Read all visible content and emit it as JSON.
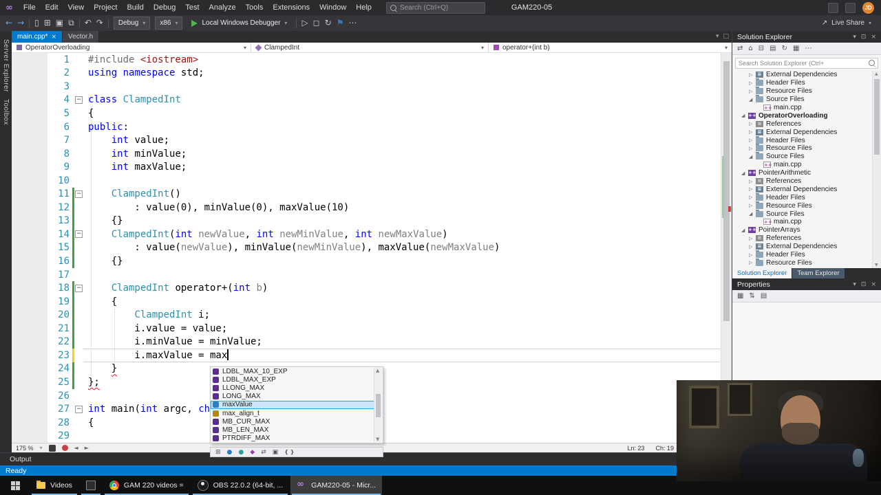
{
  "menu": {
    "items": [
      "File",
      "Edit",
      "View",
      "Project",
      "Build",
      "Debug",
      "Test",
      "Analyze",
      "Tools",
      "Extensions",
      "Window",
      "Help"
    ],
    "search_placeholder": "Search (Ctrl+Q)",
    "title": "GAM220-05",
    "avatar": "JD"
  },
  "toolbar": {
    "config": "Debug",
    "platform": "x86",
    "run": "Local Windows Debugger",
    "live_share": "Live Share"
  },
  "doc_tabs": [
    {
      "label": "main.cpp*",
      "active": true
    },
    {
      "label": "Vector.h",
      "active": false
    }
  ],
  "breadcrumb": {
    "scope": "OperatorOverloading",
    "type": "ClampedInt",
    "member": "operator+(int b)"
  },
  "side_tabs": [
    "Server Explorer",
    "Toolbox"
  ],
  "editor": {
    "zoom": "175 %",
    "status": {
      "line": "Ln: 23",
      "col": "Ch: 19"
    },
    "lines": [
      {
        "n": 1,
        "t": [
          [
            "pp",
            "#include "
          ],
          [
            "str",
            "<iostream>"
          ]
        ]
      },
      {
        "n": 2,
        "t": [
          [
            "kw",
            "using"
          ],
          [
            "pl",
            " "
          ],
          [
            "kw",
            "namespace"
          ],
          [
            "pl",
            " std;"
          ]
        ]
      },
      {
        "n": 3,
        "t": []
      },
      {
        "n": 4,
        "fold": true,
        "t": [
          [
            "kw",
            "class"
          ],
          [
            "pl",
            " "
          ],
          [
            "ty",
            "ClampedInt"
          ]
        ]
      },
      {
        "n": 5,
        "t": [
          [
            "pl",
            "{"
          ]
        ]
      },
      {
        "n": 6,
        "t": [
          [
            "kw",
            "public"
          ],
          [
            "pl",
            ":"
          ]
        ]
      },
      {
        "n": 7,
        "t": [
          [
            "pl",
            "    "
          ],
          [
            "kw",
            "int"
          ],
          [
            "pl",
            " value;"
          ]
        ]
      },
      {
        "n": 8,
        "t": [
          [
            "pl",
            "    "
          ],
          [
            "kw",
            "int"
          ],
          [
            "pl",
            " minValue;"
          ]
        ]
      },
      {
        "n": 9,
        "t": [
          [
            "pl",
            "    "
          ],
          [
            "kw",
            "int"
          ],
          [
            "pl",
            " maxValue;"
          ]
        ]
      },
      {
        "n": 10,
        "t": []
      },
      {
        "n": 11,
        "fold": true,
        "chg": "g",
        "t": [
          [
            "pl",
            "    "
          ],
          [
            "ty",
            "ClampedInt"
          ],
          [
            "pl",
            "()"
          ]
        ]
      },
      {
        "n": 12,
        "chg": "g",
        "t": [
          [
            "pl",
            "        : value(0), minValue(0), maxValue(10)"
          ]
        ]
      },
      {
        "n": 13,
        "chg": "g",
        "t": [
          [
            "pl",
            "    {}"
          ]
        ]
      },
      {
        "n": 14,
        "fold": true,
        "chg": "g",
        "t": [
          [
            "pl",
            "    "
          ],
          [
            "ty",
            "ClampedInt"
          ],
          [
            "pl",
            "("
          ],
          [
            "kw",
            "int"
          ],
          [
            "pl",
            " "
          ],
          [
            "pa",
            "newValue"
          ],
          [
            "pl",
            ", "
          ],
          [
            "kw",
            "int"
          ],
          [
            "pl",
            " "
          ],
          [
            "pa",
            "newMinValue"
          ],
          [
            "pl",
            ", "
          ],
          [
            "kw",
            "int"
          ],
          [
            "pl",
            " "
          ],
          [
            "pa",
            "newMaxValue"
          ],
          [
            "pl",
            ")"
          ]
        ]
      },
      {
        "n": 15,
        "chg": "g",
        "t": [
          [
            "pl",
            "        : value("
          ],
          [
            "pa",
            "newValue"
          ],
          [
            "pl",
            "), minValue("
          ],
          [
            "pa",
            "newMinValue"
          ],
          [
            "pl",
            "), maxValue("
          ],
          [
            "pa",
            "newMaxValue"
          ],
          [
            "pl",
            ")"
          ]
        ]
      },
      {
        "n": 16,
        "chg": "g",
        "t": [
          [
            "pl",
            "    {}"
          ]
        ]
      },
      {
        "n": 17,
        "t": []
      },
      {
        "n": 18,
        "fold": true,
        "chg": "g",
        "t": [
          [
            "pl",
            "    "
          ],
          [
            "ty",
            "ClampedInt"
          ],
          [
            "pl",
            " operator+("
          ],
          [
            "kw",
            "int"
          ],
          [
            "pl",
            " "
          ],
          [
            "pa",
            "b"
          ],
          [
            "pl",
            ")"
          ]
        ]
      },
      {
        "n": 19,
        "chg": "g",
        "t": [
          [
            "pl",
            "    {"
          ]
        ]
      },
      {
        "n": 20,
        "chg": "g",
        "t": [
          [
            "pl",
            "        "
          ],
          [
            "ty",
            "ClampedInt"
          ],
          [
            "pl",
            " i;"
          ]
        ]
      },
      {
        "n": 21,
        "chg": "g",
        "t": [
          [
            "pl",
            "        i.value = value;"
          ]
        ]
      },
      {
        "n": 22,
        "chg": "g",
        "t": [
          [
            "pl",
            "        i.minValue = minValue;"
          ]
        ]
      },
      {
        "n": 23,
        "chg": "y",
        "caret": true,
        "cur": true,
        "t": [
          [
            "pl",
            "        i.maxValue = max"
          ]
        ]
      },
      {
        "n": 24,
        "chg": "g",
        "t": [
          [
            "pl",
            "    "
          ],
          [
            "sq",
            "}"
          ]
        ]
      },
      {
        "n": 25,
        "chg": "g",
        "t": [
          [
            "sq",
            "};"
          ]
        ]
      },
      {
        "n": 26,
        "t": []
      },
      {
        "n": 27,
        "fold": true,
        "t": [
          [
            "kw",
            "int"
          ],
          [
            "pl",
            " main("
          ],
          [
            "kw",
            "int"
          ],
          [
            "pl",
            " argc, "
          ],
          [
            "kw",
            "ch"
          ]
        ]
      },
      {
        "n": 28,
        "t": [
          [
            "pl",
            "{"
          ]
        ]
      },
      {
        "n": 29,
        "t": []
      }
    ]
  },
  "intellisense": {
    "items": [
      {
        "icon": "macro",
        "label": "LDBL_MAX_10_EXP"
      },
      {
        "icon": "macro",
        "label": "LDBL_MAX_EXP"
      },
      {
        "icon": "macro",
        "label": "LLONG_MAX"
      },
      {
        "icon": "macro",
        "label": "LONG_MAX"
      },
      {
        "icon": "field",
        "label": "maxValue",
        "selected": true
      },
      {
        "icon": "struct",
        "label": "max_align_t"
      },
      {
        "icon": "macro",
        "label": "MB_CUR_MAX"
      },
      {
        "icon": "macro",
        "label": "MB_LEN_MAX"
      },
      {
        "icon": "macro",
        "label": "PTRDIFF_MAX"
      }
    ],
    "toolbar_icons": [
      "grid",
      "dotb",
      "dott",
      "diamond",
      "swap",
      "box",
      "braces"
    ]
  },
  "solution_explorer": {
    "title": "Solution Explorer",
    "toolbar_icons": [
      "sync",
      "home",
      "collapse",
      "files",
      "refresh",
      "props",
      "more"
    ],
    "search_placeholder": "Search Solution Explorer (Ctrl+",
    "tree": [
      {
        "ind": 2,
        "exp": "c",
        "icon": "ext",
        "label": "External Dependencies"
      },
      {
        "ind": 2,
        "exp": "c",
        "icon": "folder",
        "label": "Header Files"
      },
      {
        "ind": 2,
        "exp": "c",
        "icon": "folder",
        "label": "Resource Files"
      },
      {
        "ind": 2,
        "exp": "e",
        "icon": "folder",
        "label": "Source Files"
      },
      {
        "ind": 3,
        "exp": "",
        "icon": "cpp",
        "label": "main.cpp"
      },
      {
        "ind": 1,
        "exp": "e",
        "icon": "proj",
        "label": "OperatorOverloading",
        "bold": true
      },
      {
        "ind": 2,
        "exp": "c",
        "icon": "ref",
        "label": "References"
      },
      {
        "ind": 2,
        "exp": "c",
        "icon": "ext",
        "label": "External Dependencies"
      },
      {
        "ind": 2,
        "exp": "c",
        "icon": "folder",
        "label": "Header Files"
      },
      {
        "ind": 2,
        "exp": "c",
        "icon": "folder",
        "label": "Resource Files"
      },
      {
        "ind": 2,
        "exp": "e",
        "icon": "folder",
        "label": "Source Files"
      },
      {
        "ind": 3,
        "exp": "",
        "icon": "cpp",
        "label": "main.cpp"
      },
      {
        "ind": 1,
        "exp": "e",
        "icon": "proj",
        "label": "PointerArithmetic"
      },
      {
        "ind": 2,
        "exp": "c",
        "icon": "ref",
        "label": "References"
      },
      {
        "ind": 2,
        "exp": "c",
        "icon": "ext",
        "label": "External Dependencies"
      },
      {
        "ind": 2,
        "exp": "c",
        "icon": "folder",
        "label": "Header Files"
      },
      {
        "ind": 2,
        "exp": "c",
        "icon": "folder",
        "label": "Resource Files"
      },
      {
        "ind": 2,
        "exp": "e",
        "icon": "folder",
        "label": "Source Files"
      },
      {
        "ind": 3,
        "exp": "",
        "icon": "cpp",
        "label": "main.cpp"
      },
      {
        "ind": 1,
        "exp": "e",
        "icon": "proj",
        "label": "PointerArrays"
      },
      {
        "ind": 2,
        "exp": "c",
        "icon": "ref",
        "label": "References"
      },
      {
        "ind": 2,
        "exp": "c",
        "icon": "ext",
        "label": "External Dependencies"
      },
      {
        "ind": 2,
        "exp": "c",
        "icon": "folder",
        "label": "Header Files"
      },
      {
        "ind": 2,
        "exp": "c",
        "icon": "folder",
        "label": "Resource Files"
      }
    ],
    "tabs": [
      "Solution Explorer",
      "Team Explorer"
    ]
  },
  "properties": {
    "title": "Properties",
    "toolbar_icons": [
      "catg",
      "alpha",
      "sheet"
    ]
  },
  "output": {
    "label": "Output"
  },
  "statusbar": {
    "text": "Ready"
  },
  "taskbar": {
    "items": [
      {
        "icon": "explorer",
        "label": "Videos"
      },
      {
        "icon": "app",
        "label": ""
      },
      {
        "icon": "chrome",
        "label": "GAM 220 videos ="
      },
      {
        "icon": "obs",
        "label": "OBS 22.0.2 (64-bit, ..."
      },
      {
        "icon": "vs",
        "label": "GAM220-05 - Micr...",
        "active": true
      }
    ]
  },
  "colors": {
    "accent": "#007acc",
    "keyword": "#0000ff",
    "type": "#2b91af",
    "string": "#a31515",
    "changed_saved": "#3fa33f",
    "changed_unsaved": "#f2d21b"
  }
}
